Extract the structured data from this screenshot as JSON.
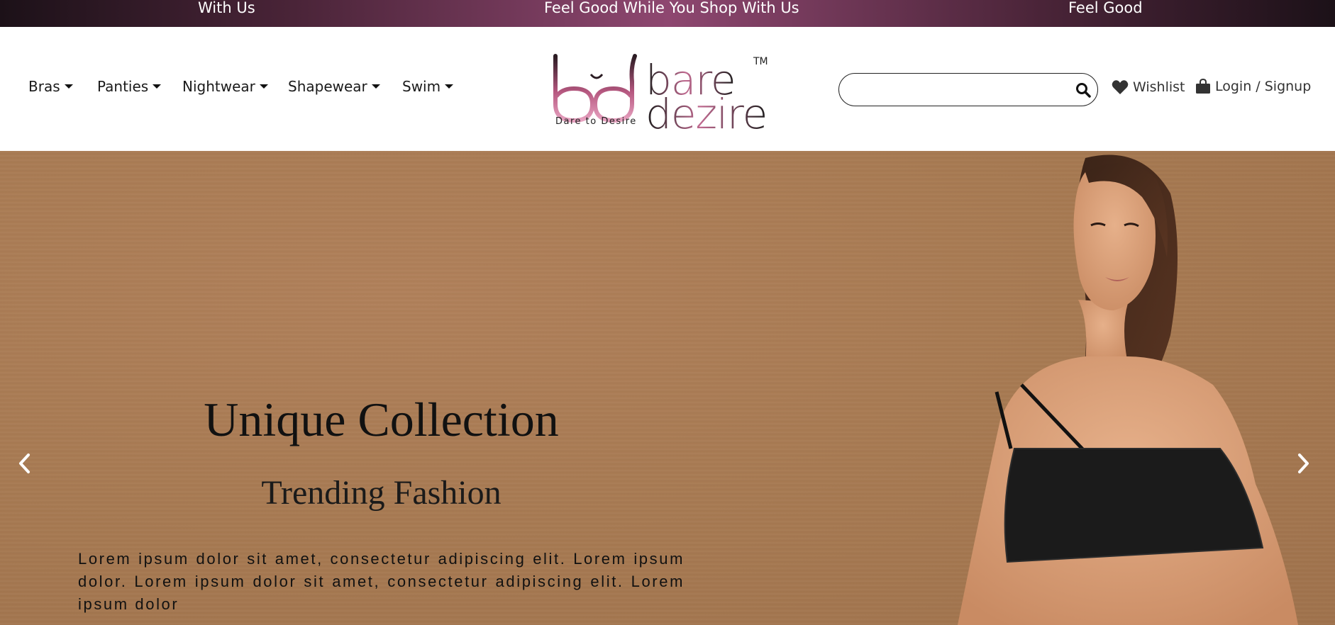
{
  "announcement": {
    "left": "With Us",
    "center": "Feel Good While You Shop With Us",
    "right": "Feel Good"
  },
  "nav": {
    "items": [
      {
        "label": "Bras"
      },
      {
        "label": "Panties"
      },
      {
        "label": "Nightwear"
      },
      {
        "label": "Shapewear"
      },
      {
        "label": "Swim"
      }
    ]
  },
  "logo": {
    "wordmark_line1": "bare",
    "wordmark_line2": "dezire",
    "tagline": "Dare to Desire",
    "trademark": "TM"
  },
  "search": {
    "value": "",
    "placeholder": ""
  },
  "header_actions": {
    "wishlist_label": "Wishlist",
    "login_label": "Login / Signup"
  },
  "hero": {
    "title": "Unique Collection",
    "subtitle": "Trending Fashion",
    "body": "Lorem ipsum dolor sit amet, consectetur adipiscing elit. Lorem ipsum dolor. Lorem ipsum dolor sit amet, consectetur adipiscing elit. Lorem ipsum dolor"
  },
  "colors": {
    "brand_pink": "#b5577f",
    "announcement_mid": "#8e4770",
    "hero_background": "#a77a52",
    "text_dark": "#111111"
  },
  "icons": {
    "search": "search-icon",
    "wishlist": "heart-icon",
    "login": "shopping-bag-icon",
    "prev": "chevron-left-icon",
    "next": "chevron-right-icon"
  }
}
